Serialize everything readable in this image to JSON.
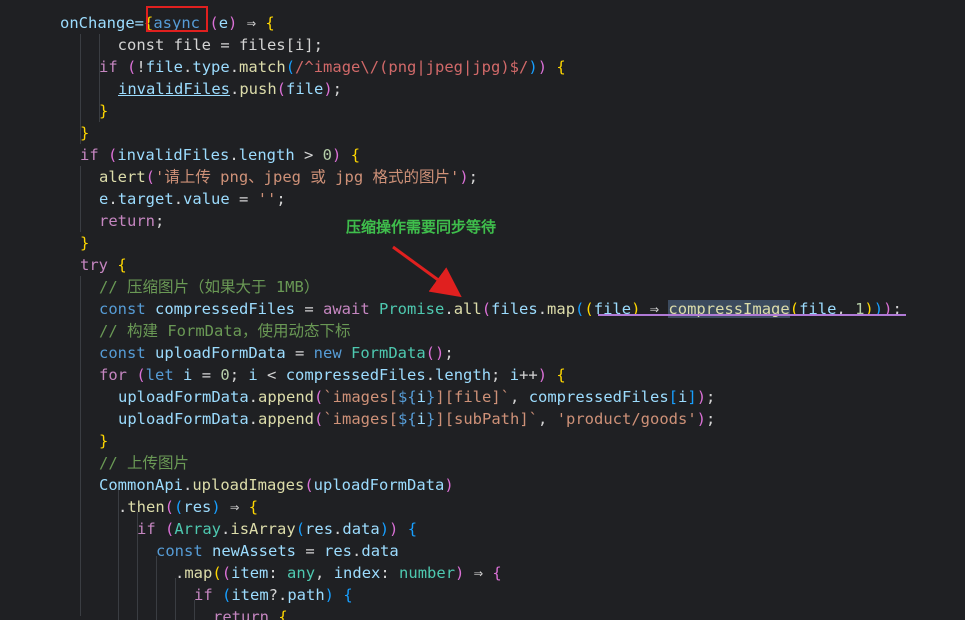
{
  "annotation": {
    "callout_text": "压缩操作需要同步等待",
    "highlight_color": "#e0201f",
    "callout_color": "#3fbe4c",
    "arrow_color": "#e0201f"
  },
  "code_lines": [
    [
      [
        "onChange=",
        "prop"
      ],
      [
        "{",
        "b1"
      ],
      [
        "async",
        "kw"
      ],
      [
        " (",
        "b2"
      ],
      [
        "e",
        "prop"
      ],
      [
        ")",
        "b2"
      ],
      [
        " ⇒ ",
        "op"
      ],
      [
        "{",
        "b1"
      ]
    ],
    [
      [
        "  const file = files[i];",
        "default"
      ]
    ],
    [
      [
        "  ",
        "default"
      ],
      [
        "if",
        "ctrl"
      ],
      [
        " (",
        "b2"
      ],
      [
        "!",
        "op"
      ],
      [
        "file",
        "prop"
      ],
      [
        ".",
        "op"
      ],
      [
        "type",
        "prop"
      ],
      [
        ".",
        "op"
      ],
      [
        "match",
        "fn"
      ],
      [
        "(",
        "b3"
      ],
      [
        "/^image\\/(png|jpeg|jpg)$/",
        "regex"
      ],
      [
        ")",
        "b3"
      ],
      [
        ")",
        "b2"
      ],
      [
        " {",
        "b1"
      ]
    ],
    [
      [
        "    ",
        "default"
      ],
      [
        "invalidFiles",
        "prop"
      ],
      [
        ".",
        "op"
      ],
      [
        "push",
        "fn"
      ],
      [
        "(",
        "b2"
      ],
      [
        "file",
        "prop"
      ],
      [
        ")",
        "b2"
      ],
      [
        ";",
        "op"
      ]
    ],
    [
      [
        "  ",
        "default"
      ],
      [
        "}",
        "b1"
      ]
    ],
    [
      [
        "}",
        "b1"
      ]
    ],
    [
      [
        "if",
        "ctrl"
      ],
      [
        " (",
        "b2"
      ],
      [
        "invalidFiles",
        "prop"
      ],
      [
        ".",
        "op"
      ],
      [
        "length",
        "prop"
      ],
      [
        " > ",
        "op"
      ],
      [
        "0",
        "num"
      ],
      [
        ")",
        "b2"
      ],
      [
        " {",
        "b1"
      ]
    ],
    [
      [
        "  ",
        "default"
      ],
      [
        "alert",
        "fn"
      ],
      [
        "(",
        "b2"
      ],
      [
        "'请上传 png、jpeg 或 jpg 格式的图片'",
        "str"
      ],
      [
        ")",
        "b2"
      ],
      [
        ";",
        "op"
      ]
    ],
    [
      [
        "  ",
        "default"
      ],
      [
        "e",
        "prop"
      ],
      [
        ".",
        "op"
      ],
      [
        "target",
        "prop"
      ],
      [
        ".",
        "op"
      ],
      [
        "value",
        "prop"
      ],
      [
        " = ",
        "op"
      ],
      [
        "''",
        "str"
      ],
      [
        ";",
        "op"
      ]
    ],
    [
      [
        "  ",
        "default"
      ],
      [
        "return",
        "ctrl"
      ],
      [
        ";",
        "op"
      ]
    ],
    [
      [
        "}",
        "b1"
      ]
    ],
    [
      [
        "try",
        "ctrl"
      ],
      [
        " {",
        "b1"
      ]
    ],
    [
      [
        "  ",
        "default"
      ],
      [
        "// 压缩图片（如果大于 1MB）",
        "comment"
      ]
    ],
    [
      [
        "  ",
        "default"
      ],
      [
        "const",
        "kw"
      ],
      [
        " ",
        "default"
      ],
      [
        "compressedFiles",
        "prop"
      ],
      [
        " = ",
        "op"
      ],
      [
        "await",
        "ctrl"
      ],
      [
        " ",
        "default"
      ],
      [
        "Promise",
        "type"
      ],
      [
        ".",
        "op"
      ],
      [
        "all",
        "fn"
      ],
      [
        "(",
        "b2"
      ],
      [
        "files",
        "prop"
      ],
      [
        ".",
        "op"
      ],
      [
        "map",
        "fn"
      ],
      [
        "(",
        "b3"
      ],
      [
        "(",
        "b1"
      ],
      [
        "file",
        "prop"
      ],
      [
        ")",
        "b1"
      ],
      [
        " ⇒ ",
        "op"
      ],
      [
        "compressImage",
        "fn"
      ],
      [
        "(",
        "b1"
      ],
      [
        "file",
        "prop"
      ],
      [
        ", ",
        "op"
      ],
      [
        "1",
        "num"
      ],
      [
        ")",
        "b1"
      ],
      [
        ")",
        "b3"
      ],
      [
        ")",
        "b2"
      ],
      [
        ";",
        "op"
      ]
    ],
    [
      [
        "  ",
        "default"
      ],
      [
        "// 构建 FormData，使用动态下标",
        "comment"
      ]
    ],
    [
      [
        "  ",
        "default"
      ],
      [
        "const",
        "kw"
      ],
      [
        " ",
        "default"
      ],
      [
        "uploadFormData",
        "prop"
      ],
      [
        " = ",
        "op"
      ],
      [
        "new",
        "kw"
      ],
      [
        " ",
        "default"
      ],
      [
        "FormData",
        "type"
      ],
      [
        "()",
        "b2"
      ],
      [
        ";",
        "op"
      ]
    ],
    [
      [
        "  ",
        "default"
      ],
      [
        "for",
        "ctrl"
      ],
      [
        " (",
        "b2"
      ],
      [
        "let",
        "kw"
      ],
      [
        " ",
        "default"
      ],
      [
        "i",
        "prop"
      ],
      [
        " = ",
        "op"
      ],
      [
        "0",
        "num"
      ],
      [
        "; ",
        "op"
      ],
      [
        "i",
        "prop"
      ],
      [
        " < ",
        "op"
      ],
      [
        "compressedFiles",
        "prop"
      ],
      [
        ".",
        "op"
      ],
      [
        "length",
        "prop"
      ],
      [
        "; ",
        "op"
      ],
      [
        "i",
        "prop"
      ],
      [
        "++",
        "op"
      ],
      [
        ")",
        "b2"
      ],
      [
        " {",
        "b1"
      ]
    ],
    [
      [
        "    ",
        "default"
      ],
      [
        "uploadFormData",
        "prop"
      ],
      [
        ".",
        "op"
      ],
      [
        "append",
        "fn"
      ],
      [
        "(",
        "b2"
      ],
      [
        "`images[",
        "str"
      ],
      [
        "${",
        "kw"
      ],
      [
        "i",
        "prop"
      ],
      [
        "}",
        "kw"
      ],
      [
        "][file]`",
        "str"
      ],
      [
        ", ",
        "op"
      ],
      [
        "compressedFiles",
        "prop"
      ],
      [
        "[",
        "b3"
      ],
      [
        "i",
        "prop"
      ],
      [
        "]",
        "b3"
      ],
      [
        ")",
        "b2"
      ],
      [
        ";",
        "op"
      ]
    ],
    [
      [
        "    ",
        "default"
      ],
      [
        "uploadFormData",
        "prop"
      ],
      [
        ".",
        "op"
      ],
      [
        "append",
        "fn"
      ],
      [
        "(",
        "b2"
      ],
      [
        "`images[",
        "str"
      ],
      [
        "${",
        "kw"
      ],
      [
        "i",
        "prop"
      ],
      [
        "}",
        "kw"
      ],
      [
        "][subPath]`",
        "str"
      ],
      [
        ", ",
        "op"
      ],
      [
        "'product/goods'",
        "str"
      ],
      [
        ")",
        "b2"
      ],
      [
        ";",
        "op"
      ]
    ],
    [
      [
        "  ",
        "default"
      ],
      [
        "}",
        "b1"
      ]
    ],
    [
      [
        "  ",
        "default"
      ],
      [
        "// 上传图片",
        "comment"
      ]
    ],
    [
      [
        "  ",
        "default"
      ],
      [
        "CommonApi",
        "prop"
      ],
      [
        ".",
        "op"
      ],
      [
        "uploadImages",
        "fn"
      ],
      [
        "(",
        "b2"
      ],
      [
        "uploadFormData",
        "prop"
      ],
      [
        ")",
        "b2"
      ]
    ],
    [
      [
        "    ",
        "default"
      ],
      [
        ".",
        "op"
      ],
      [
        "then",
        "fn"
      ],
      [
        "(",
        "b2"
      ],
      [
        "(",
        "b3"
      ],
      [
        "res",
        "prop"
      ],
      [
        ")",
        "b3"
      ],
      [
        " ⇒ ",
        "op"
      ],
      [
        "{",
        "b1"
      ]
    ],
    [
      [
        "      ",
        "default"
      ],
      [
        "if",
        "ctrl"
      ],
      [
        " (",
        "b2"
      ],
      [
        "Array",
        "type"
      ],
      [
        ".",
        "op"
      ],
      [
        "isArray",
        "fn"
      ],
      [
        "(",
        "b3"
      ],
      [
        "res",
        "prop"
      ],
      [
        ".",
        "op"
      ],
      [
        "data",
        "prop"
      ],
      [
        ")",
        "b3"
      ],
      [
        ")",
        "b2"
      ],
      [
        " {",
        "b3"
      ]
    ],
    [
      [
        "        ",
        "default"
      ],
      [
        "const",
        "kw"
      ],
      [
        " ",
        "default"
      ],
      [
        "newAssets",
        "prop"
      ],
      [
        " = ",
        "op"
      ],
      [
        "res",
        "prop"
      ],
      [
        ".",
        "op"
      ],
      [
        "data",
        "prop"
      ]
    ],
    [
      [
        "          ",
        "default"
      ],
      [
        ".",
        "op"
      ],
      [
        "map",
        "fn"
      ],
      [
        "(",
        "b1"
      ],
      [
        "(",
        "b2"
      ],
      [
        "item",
        "prop"
      ],
      [
        ": ",
        "op"
      ],
      [
        "any",
        "type"
      ],
      [
        ", ",
        "op"
      ],
      [
        "index",
        "prop"
      ],
      [
        ": ",
        "op"
      ],
      [
        "number",
        "type"
      ],
      [
        ")",
        "b2"
      ],
      [
        " ⇒ ",
        "op"
      ],
      [
        "{",
        "b2"
      ]
    ],
    [
      [
        "            ",
        "default"
      ],
      [
        "if",
        "ctrl"
      ],
      [
        " (",
        "b3"
      ],
      [
        "item",
        "prop"
      ],
      [
        "?.",
        "op"
      ],
      [
        "path",
        "prop"
      ],
      [
        ")",
        "b3"
      ],
      [
        " {",
        "b3"
      ]
    ],
    [
      [
        "              ",
        "default"
      ],
      [
        "return",
        "ctrl"
      ],
      [
        " {",
        "b1"
      ]
    ]
  ]
}
